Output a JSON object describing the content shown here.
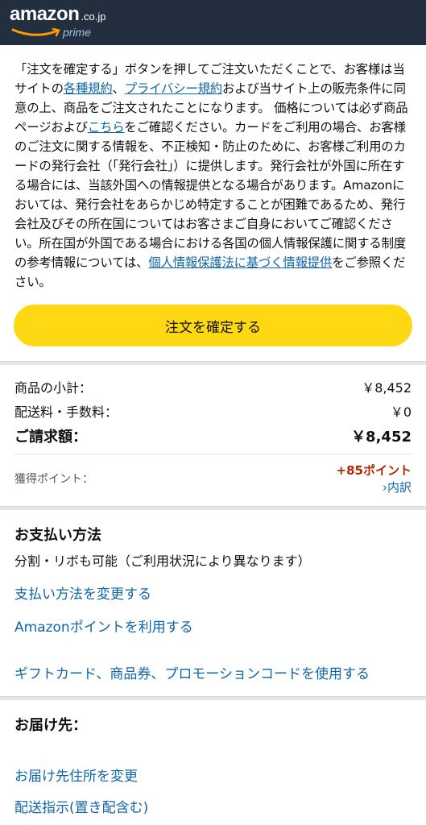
{
  "header": {
    "logo_word": "amazon",
    "logo_tld": ".co.jp",
    "logo_prime": "prime",
    "bg_color": "#232f3e"
  },
  "terms": {
    "t1": "「注文を確定する」ボタンを押してご注文いただくことで、お客様は当サイトの",
    "link_terms": "各種規約",
    "t2": "、",
    "link_privacy": "プライバシー規約",
    "t3": "および当サイト上の販売条件に同意の上、商品をご注文されたことになります。 価格については必ず商品ページおよび",
    "link_here": "こちら",
    "t4": "をご確認ください。カードをご利用の場合、お客様のご注文に関する情報を、不正検知・防止のために、お客様ご利用のカードの発行会社（「発行会社」）に提供します。発行会社が外国に所在する場合には、当該外国への情報提供となる場合があります。Amazonにおいては、発行会社をあらかじめ特定することが困難であるため、発行会社及びその所在国についてはお客さまご自身においてご確認ください。所在国が外国である場合における各国の個人情報保護に関する制度の参考情報については、",
    "link_info": "個人情報保護法に基づく情報提供",
    "t5": "をご参照ください。"
  },
  "place_order": {
    "label": "注文を確定する",
    "color": "#ffd814"
  },
  "summary": {
    "subtotal_label": "商品の小計：",
    "subtotal_value": "￥8,452",
    "shipping_label": "配送料・手数料：",
    "shipping_value": "￥0",
    "total_label": "ご請求額：",
    "total_value": "￥8,452",
    "points_label": "獲得ポイント：",
    "points_value": "+85ポイント",
    "points_detail": "›内訳"
  },
  "payment": {
    "title": "お支払い方法",
    "note": "分割・リボも可能（ご利用状況により異なります）",
    "change_link": "支払い方法を変更する",
    "points_link": "Amazonポイントを利用する",
    "gift_link": "ギフトカード、商品券、プロモーションコードを使用する"
  },
  "shipping": {
    "title": "お届け先：",
    "change_address": "お届け先住所を変更",
    "delivery_instructions": "配送指示(置き配含む)"
  },
  "colors": {
    "link": "#0f66a8",
    "points": "#b12704"
  }
}
